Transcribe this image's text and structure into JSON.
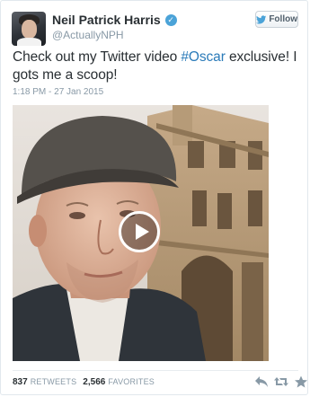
{
  "header": {
    "display_name": "Neil Patrick Harris",
    "handle": "@ActuallyNPH",
    "verified_icon": "verified-badge-icon",
    "follow_label": "Follow",
    "follow_icon": "twitter-bird-icon"
  },
  "tweet": {
    "text_before": "Check out my Twitter video ",
    "hashtag": "#Oscar",
    "text_after": " exclusive! I gots me a scoop!",
    "timestamp": "1:18 PM - 27 Jan 2015"
  },
  "media": {
    "type": "video",
    "play_icon": "play-icon"
  },
  "stats": {
    "retweets_count": "837",
    "retweets_label": "RETWEETS",
    "favorites_count": "2,566",
    "favorites_label": "FAVORITES"
  },
  "actions": {
    "reply_icon": "reply-icon",
    "retweet_icon": "retweet-icon",
    "favorite_icon": "star-icon"
  },
  "colors": {
    "link": "#2b7bb9",
    "muted": "#8899a6",
    "verified": "#4ba3d8"
  }
}
